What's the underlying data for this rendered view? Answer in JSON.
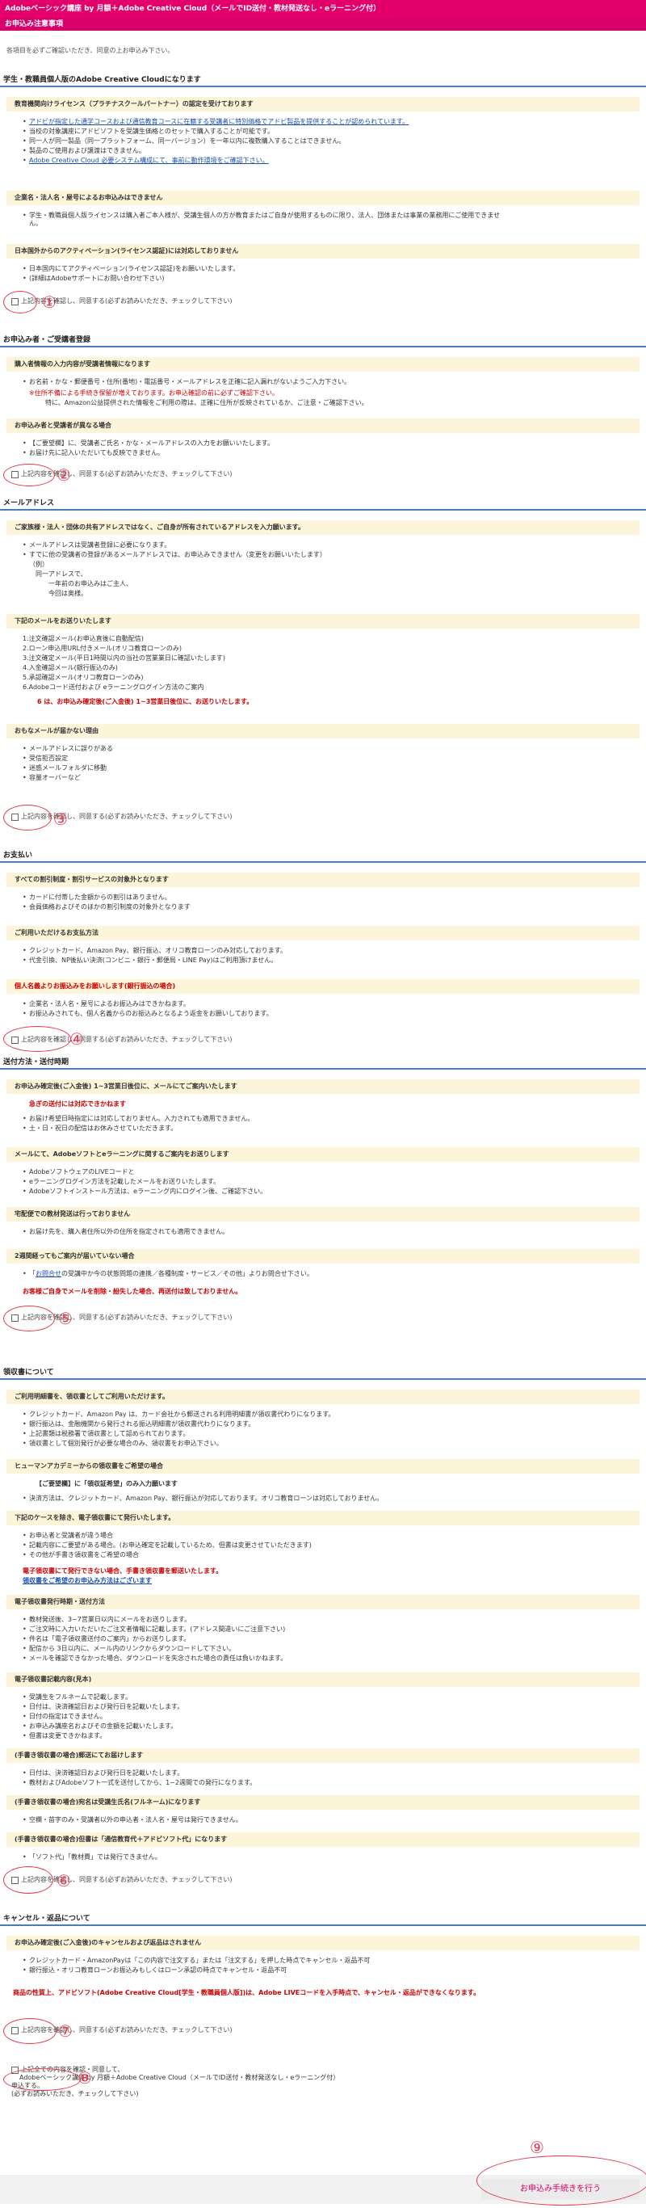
{
  "header": {
    "title": "Adobeベーシック講座 by 月額＋Adobe Creative Cloud（メールでID送付・教材発送なし・eラーニング付）",
    "subtitle": "お申込み注意事項",
    "intro": "各項目を必ずご確認いただき、同意の上お申込み下さい。"
  },
  "agree_label": "上記内容を確認し、同意する(必ずお読みいただき、チェックして下さい)",
  "sections": {
    "s1": {
      "title": "学生・教職員個人版のAdobe Creative Cloudになります",
      "sub1": "教育機関向けライセンス（プラチナスクールパートナー）の認定を受けております",
      "sub1_items": [
        "アドビが指定した通学コースおよび通信教育コースに在籍する受講者に特別価格でアドビ製品を提供することが認められています。",
        "当校の対象講座にアドビソフトを受講生価格とのセットで購入することが可能です。",
        "同一人が同一製品（同一プラットフォーム、同一バージョン）を一年以内に複数購入することはできません。",
        "製品のご使用および譲渡はできません。",
        "Adobe Creative Cloud 必要システム構成にて、事前に動作環境をご確認下さい。"
      ],
      "sub2": "企業名・法人名・屋号によるお申込みはできません",
      "sub2_items": [
        "学生・教職員個人版ライセンスは購入者ご本人様が、受講生個人の方が教育またはご自身が使用するものに限り、法人、団体または事業の業務用にご使用できません。"
      ],
      "sub3": "日本国外からのアクティベーション(ライセンス認証)には対応しておりません",
      "sub3_items": [
        "日本国内にてアクティベーション(ライセンス認証)をお願いいたします。",
        "(詳細はAdobeサポートにお問い合わせ下さい)"
      ]
    },
    "s2": {
      "title": "お申込み者・ご受講者登録",
      "sub1": "購入者情報の入力内容が受講者情報になります",
      "sub1_text1": "お名前・かな・郵便番号・住所(番地)・電話番号・メールアドレスを正確に記入漏れがないようご入力下さい。",
      "sub1_text2": "※住所不備による手続き保留が増えております。お申込確認の前に必ずご確認下さい。",
      "sub1_text3": "特に、Amazon公益提供された情報をご利用の際は、正確に住所が反映されているか、ご注意・ご確認下さい。",
      "sub2": "お申込み者と受講者が異なる場合",
      "sub2_items": [
        "【ご要望欄】に、受講者ご氏名・かな・メールアドレスの入力をお願いいたします。",
        "お届け先に記入いただいても反映できません。"
      ]
    },
    "s3": {
      "title": "メールアドレス",
      "sub1": "ご家族様・法人・団体の共有アドレスではなく、ご自身が所有されているアドレスを入力願います。",
      "sub1_items": [
        "メールアドレスは受講者登録に必要になります。",
        "すでに他の受講者の登録があるメールアドレスでは、お申込みできません（変更をお願いいたします）"
      ],
      "sub1_example": [
        "（例）",
        "同一アドレスで、",
        "一年前のお申込みはご主人、",
        "今回は奥様。"
      ],
      "sub2": "下記のメールをお送りいたします",
      "sub2_items": [
        "1.注文確認メール(お申込直後に自動配信)",
        "2.ローン申込用URL付きメール(オリコ教育ローンのみ)",
        "3.注文確定メール(平日1時間以内の当社の営業業日に確認いたします)",
        "4.入金確認メール(銀行振込のみ)",
        "5.承認確認メール(オリコ教育ローンのみ)",
        "6.Adobeコード送付および eラーニングログイン方法のご案内"
      ],
      "sub2_note": "6 は、お申込み確定後(ご入金後) 1~3営業日後位に、お送りいたします。",
      "sub3": "おもなメールが届かない理由",
      "sub3_items": [
        "メールアドレスに誤りがある",
        "受信拒否設定",
        "迷惑メールフォルダに移動",
        "容量オーバーなど"
      ]
    },
    "s4": {
      "title": "お支払い",
      "sub1": "すべての割引制度・割引サービスの対象外となります",
      "sub1_items": [
        "カードに付帯した金額からの割引はありません。",
        "会員価格およびそのほかの割引制度の対象外となります"
      ],
      "sub2": "ご利用いただけるお支払方法",
      "sub2_items": [
        "クレジットカード、Amazon Pay、銀行振込、オリコ教育ローンのみ対応しております。",
        "代金引換、NP後払い決済(コンビニ・銀行・郵便局・LINE Pay)はご利用頂けません。"
      ],
      "sub3": "個人名義よりお振込みをお願いします(銀行振込の場合)",
      "sub3_items": [
        "企業名・法人名・屋号によるお振込みはできかねます。",
        "お振込みされても、個人名義からのお振込みとなるよう返金をお願いしております。"
      ]
    },
    "s5": {
      "title": "送付方法・送付時期",
      "sub1": "お申込み確定後(ご入金後) 1~3営業日後位に、メールにてご案内いたします",
      "sub1_note": "急ぎの送付には対応できかねます",
      "sub1_items": [
        "お届け希望日時指定には対応しておりません。入力されても適用できません。",
        "土・日・祝日の配信はお休みさせていただきます。"
      ],
      "sub2": "メールにて、Adobeソフトとeラーニングに関するご案内をお送りします",
      "sub2_items": [
        "AdobeソフトウェアのLIVEコードと",
        "eラーニングログイン方法を記載したメールをお送りいたします。",
        "Adobeソフトインストール方法は、eラーニング内にログイン後、ご確認下さい。"
      ],
      "sub3": "宅配便での教材発送は行っておりません",
      "sub3_items": [
        "お届け先を、購入者住所以外の住所を指定されても適用できません。"
      ],
      "sub4": "2週間経ってもご案内が届いていない場合",
      "sub4_link": "お問合せ",
      "sub4_text": "の受講中か今の状態問題の連携／各種制度・サービス／その他」よりお問合せ下さい。",
      "sub4_note": "お客様ご自身でメールを削除・紛失した場合、再送付は致しておりません。"
    },
    "s6": {
      "title": "領収書について",
      "sub1": "ご利用明細書を、領収書としてご利用いただけます。",
      "sub1_items": [
        "クレジットカード、Amazon Pay は、カード会社から郵送される利用明細書が領収書代わりになります。",
        "銀行振込は、金融機関から発行される振込明細書が領収書代わりになります。",
        "上記書類は税務署で領収書として認められております。",
        "領収書として個別発行が必要な場合のみ、領収書をお申込下さい。"
      ],
      "sub2": "ヒューマンアカデミーからの領収書をご希望の場合",
      "sub2_note": "【ご要望欄】に「領収証希望」のみ入力願います",
      "sub2_items": [
        "決済方法は、クレジットカード、Amazon Pay、銀行振込が対応しております。オリコ教育ローンは対応しておりません。"
      ],
      "sub3": "下記のケースを除き、電子領収書にて発行いたします。",
      "sub3_items": [
        "お申込者と受講者が違う場合",
        "記載内容にご要望がある場合。(お申込確定を記載しているため、但書は変更させていただきます)",
        "その他が手書き領収書をご希望の場合"
      ],
      "sub3_note1": "電子領収書にて発行できない場合、手書き領収書を郵送いたします。",
      "sub3_note2": "領収書をご希望のお申込み方法はございます",
      "sub4": "電子領収書発行時期・送付方法",
      "sub4_items": [
        "教材発送後、3~7営業日以内にメールをお送りします。",
        "ご注文時に入力いただいたご注文者情報に記載します。(アドレス間違いにご注意下さい)",
        "件名は「電子領収書送付のご案内」からお送りします。",
        "配信から 3日以内に、メール内のリンクからダウンロードして下さい。",
        "メールを確認できなかった場合、ダウンロードを失念された場合の責任は負いかねます。"
      ],
      "sub5": "電子領収書記載内容(見本)",
      "sub5_items": [
        "受講生をフルネームで記載します。",
        "日付は、決済確認日および発行日を記載いたします。",
        "日付の指定はできません。",
        "お申込み講座名およびその金額を記載いたします。",
        "但書は変更できかねます。"
      ],
      "sub6": "(手書き領収書の場合)郵送にてお届けします",
      "sub6_items": [
        "日付は、決済確認日および発行日を記載いたします。",
        "教材およびAdobeソフト一式を送付してから、1~2週間での発行になります。"
      ],
      "sub7": "(手書き領収書の場合)宛名は受講生氏名(フルネーム)になります",
      "sub7_items": [
        "空欄・苗字のみ・受講者以外の申込者・法人名・屋号は発行できません。"
      ],
      "sub8": "(手書き領収書の場合)但書は「通信教育代＋アドビソフト代」になります",
      "sub8_items": [
        "「ソフト代」「教材費」では発行できません。"
      ]
    },
    "s7": {
      "title": "キャンセル・返品について",
      "sub1": "お申込み確定後(ご入金後)のキャンセルおよび返品はされません",
      "sub1_items": [
        "クレジットカード・AmazonPayは「この内容で注文する」または「注文する」を押した時点でキャンセル・返品不可",
        "銀行振込・オリコ教育ローンお振込みもしくはローン承認の時点でキャンセル・返品不可"
      ],
      "sub1_note": "商品の性質上、アドビソフト(Adobe Creative Cloud[学生・教職員個人版])は、Adobe LIVEコードを入手時点で、キャンセル・返品ができなくなります。"
    }
  },
  "final": {
    "line1": "上記全ての内容を確認・同意して、",
    "line2": "Adobeベーシック講座 by 月額＋Adobe Creative Cloud（メールでID送付・教材発送なし・eラーニング付）",
    "line3": "申込する。",
    "line4": "(必ずお読みいただき、チェックして下さい)"
  },
  "submit_label": "お申込み手続きを行う",
  "annotations": [
    "①",
    "②",
    "③",
    "④",
    "⑤",
    "⑥",
    "⑦",
    "⑧",
    "⑨"
  ],
  "colors": {
    "brand": "#e4006b",
    "accent_red": "#cc0000",
    "link": "#1a4fb5",
    "annotation": "#e23a50"
  }
}
